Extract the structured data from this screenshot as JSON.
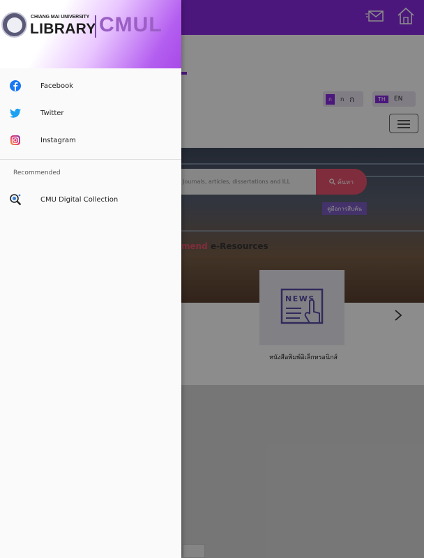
{
  "drawer": {
    "brand": {
      "university": "CHIANG MAI UNIVERSITY",
      "library": "LIBRARY",
      "short": "CMUL"
    },
    "social": [
      {
        "label": "Facebook",
        "icon": "facebook-icon"
      },
      {
        "label": "Twitter",
        "icon": "twitter-icon"
      },
      {
        "label": "Instagram",
        "icon": "instagram-icon"
      }
    ],
    "recommended_heading": "Recommended",
    "recommended": [
      {
        "label": "CMU Digital Collection",
        "icon": "magnifier-icon"
      }
    ]
  },
  "background": {
    "lang": {
      "th_badge": "ก",
      "th_1": "ก",
      "th_2": "ก",
      "en_badge": "TH",
      "en": "EN"
    },
    "search": {
      "placeholder": "Journals, articles, dissertations and ILL",
      "button": "ค้นหา"
    },
    "manual_button": "คู่มือการสืบค้น",
    "recommend_title_hl": "mend",
    "recommend_title": " e-Resources",
    "card_caption": "หนังสือพิมพ์อิเล็กทรอนิกส์",
    "card_image_text": "NEWS"
  },
  "colors": {
    "brand_purple": "#8a2be2",
    "accent_pink": "#e8526d",
    "facebook_blue": "#1877f2",
    "twitter_blue": "#1da1f2"
  }
}
